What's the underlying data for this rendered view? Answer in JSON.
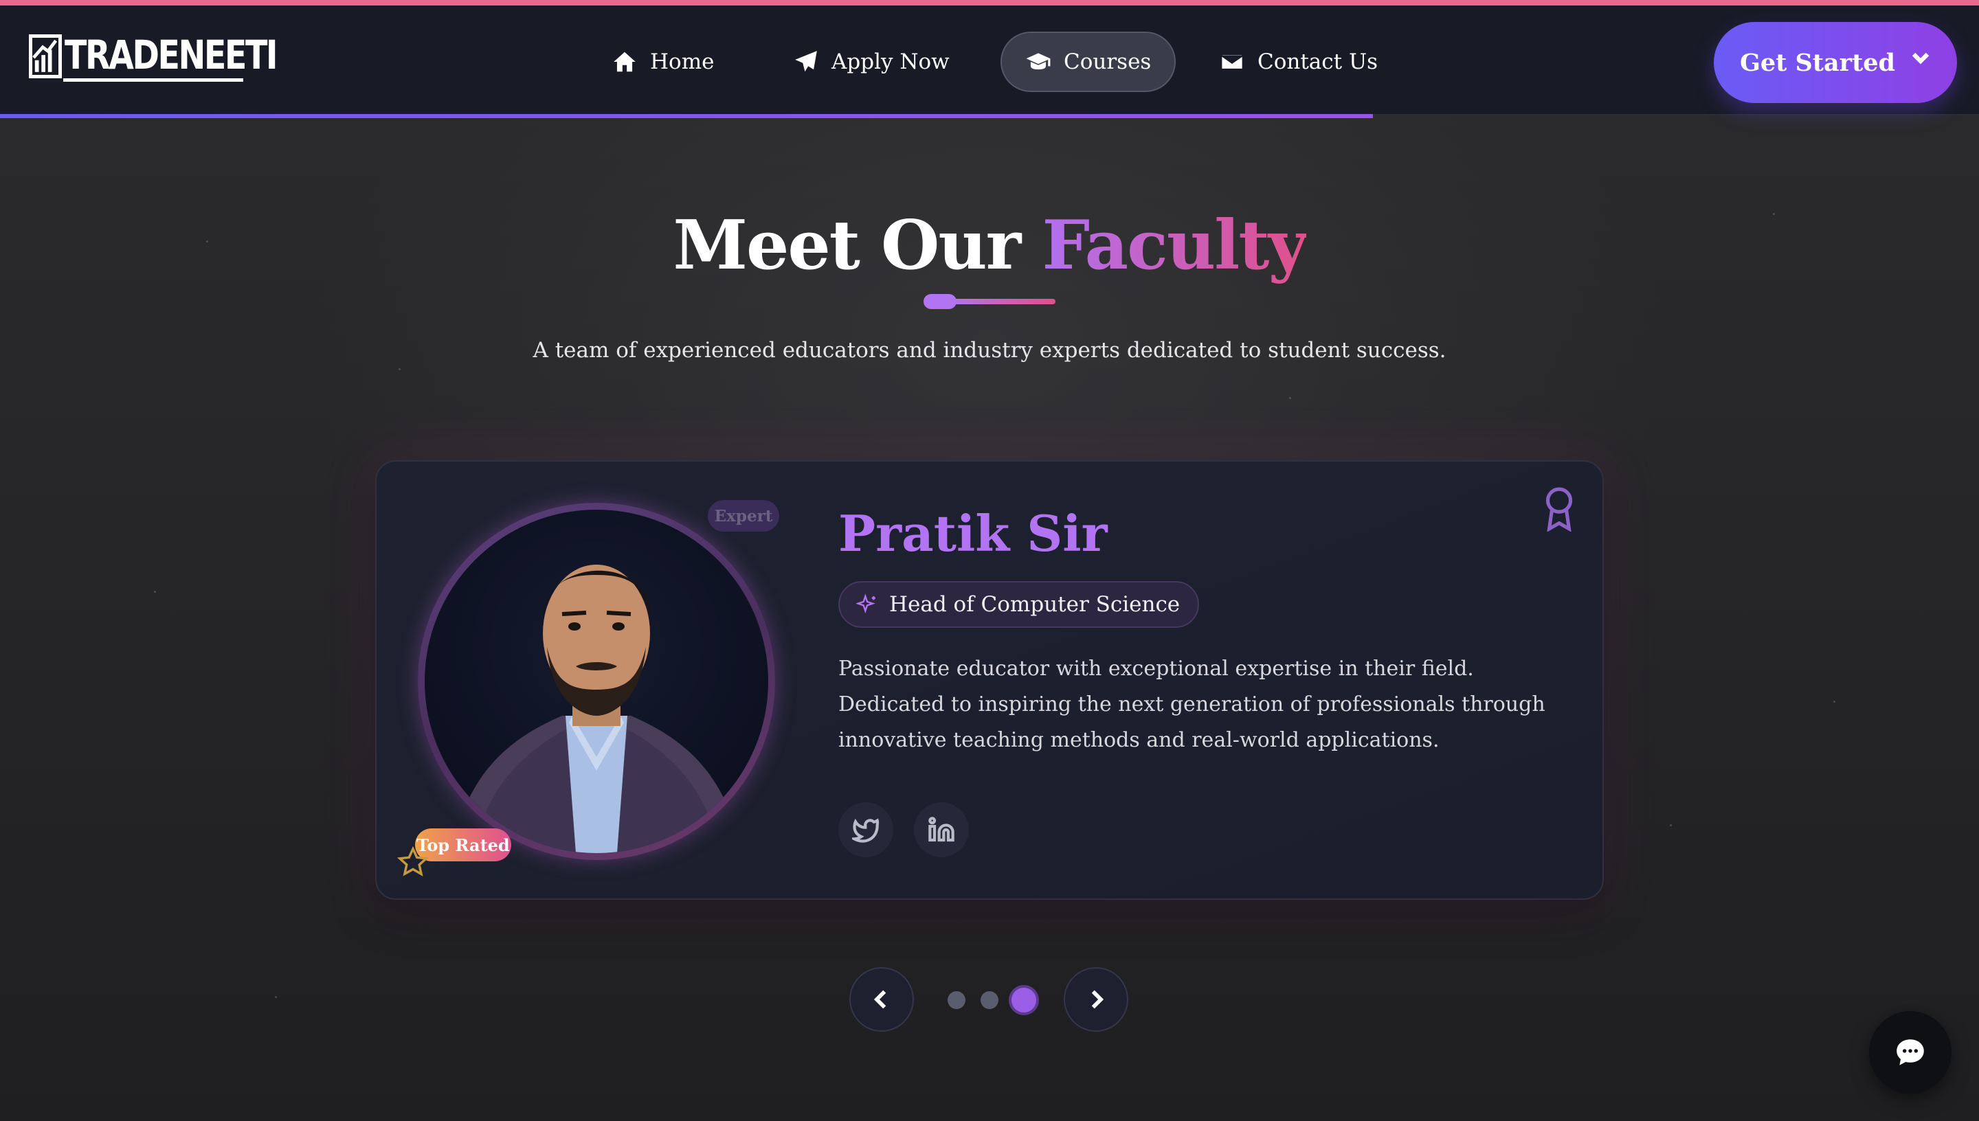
{
  "nav": {
    "brand": "TRADENEETI",
    "links": [
      {
        "label": "Home",
        "icon": "home-icon"
      },
      {
        "label": "Apply Now",
        "icon": "paper-plane-icon"
      },
      {
        "label": "Courses",
        "icon": "graduation-cap-icon",
        "active": true
      },
      {
        "label": "Contact Us",
        "icon": "envelope-icon"
      }
    ],
    "cta": "Get Started"
  },
  "section": {
    "title_main": "Meet Our",
    "title_accent": "Faculty",
    "subtitle": "A team of experienced educators and industry experts dedicated to student success."
  },
  "faculty": {
    "badge_expert": "Expert",
    "badge_top": "Top Rated",
    "name": "Pratik Sir",
    "role": "Head of Computer Science",
    "bio": "Passionate educator with exceptional expertise in their field. Dedicated to inspiring the next generation of professionals through innovative teaching methods and real-world applications.",
    "socials": [
      "twitter-icon",
      "linkedin-icon"
    ]
  },
  "carousel": {
    "total_slides": 3,
    "active_slide": 3
  },
  "colors": {
    "accent_purple": "#b274f2",
    "accent_pink": "#e0508a",
    "cta_gradient_start": "#6a5cf6",
    "cta_gradient_end": "#8f40e4"
  }
}
